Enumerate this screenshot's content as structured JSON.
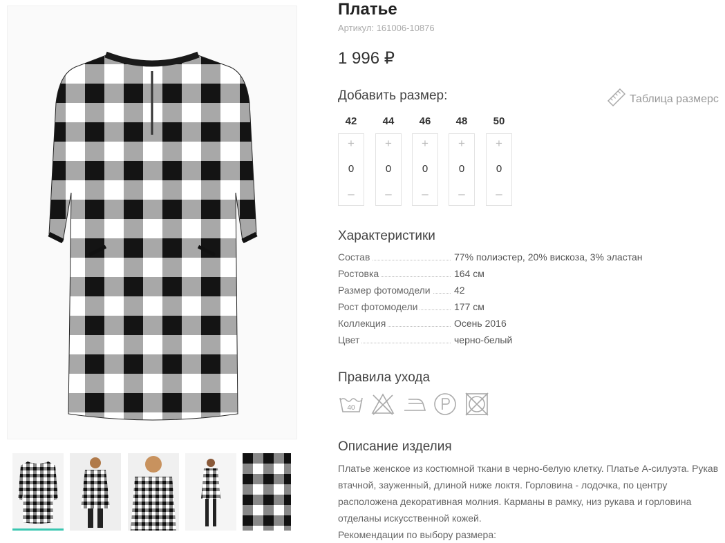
{
  "product": {
    "title": "Платье",
    "sku": "Артикул: 161006-10876",
    "price": "1 996 ₽"
  },
  "sizes_section": {
    "title": "Добавить размер:",
    "size_chart_label": "Таблица размерс",
    "sizes": [
      {
        "label": "42",
        "qty": "0"
      },
      {
        "label": "44",
        "qty": "0"
      },
      {
        "label": "46",
        "qty": "0"
      },
      {
        "label": "48",
        "qty": "0"
      },
      {
        "label": "50",
        "qty": "0"
      }
    ],
    "plus_symbol": "+",
    "minus_symbol": "–"
  },
  "specs": {
    "title": "Характеристики",
    "rows": [
      {
        "key": "Состав",
        "value": "77% полиэстер, 20% вискоза, 3% эластан"
      },
      {
        "key": "Ростовка",
        "value": "164 см"
      },
      {
        "key": "Размер фотомодели",
        "value": "42"
      },
      {
        "key": "Рост фотомодели",
        "value": "177 см"
      },
      {
        "key": "Коллекция",
        "value": "Осень 2016"
      },
      {
        "key": "Цвет",
        "value": "черно-белый"
      }
    ]
  },
  "care": {
    "title": "Правила ухода",
    "icons": [
      "wash-40-icon",
      "no-bleach-icon",
      "iron-icon",
      "dry-clean-p-icon",
      "no-tumble-dry-icon"
    ],
    "wash_temp": "40"
  },
  "description": {
    "title": "Описание изделия",
    "lines": [
      "Платье женское из костюмной ткани в черно-белую клетку. Платье А-силуэта. Рукав",
      "втачной, зауженный, длиной ниже локтя. Горловина - лодочка, по центру",
      "расположена декоративная молния. Карманы в рамку, низ рукава и горловина",
      "отделаны искусственной кожей.",
      "Рекомендации по выбору размера:"
    ]
  },
  "gallery": {
    "thumb_count": 5,
    "active_index": 0
  },
  "colors": {
    "accent": "#39c6b0",
    "plaid_dark": "#1a1a1a",
    "plaid_light": "#ffffff"
  }
}
